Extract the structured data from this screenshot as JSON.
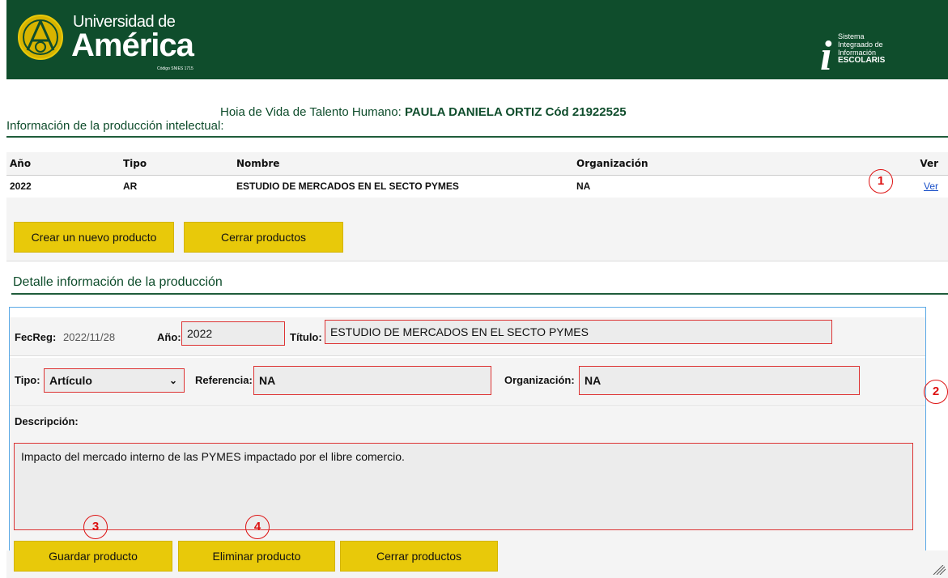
{
  "header": {
    "uni_line1": "Universidad de",
    "uni_line2": "América",
    "uni_code": "Código SNIES 1715",
    "system_lines": [
      "Sistema",
      "Integraado de",
      "Información",
      "ESCOLARIS"
    ],
    "system_letter": "i",
    "colors": {
      "brand_green": "#0f4d2c",
      "accent_yellow": "#e8c90a",
      "mark_red": "#d11111",
      "link_blue": "#1a50c8"
    }
  },
  "title": {
    "prefix": "Hoia de Vida de Talento Humano:",
    "person": "PAULA DANIELA ORTIZ",
    "cod_label": "Cód",
    "cod_value": "21922525"
  },
  "section1": {
    "heading": "Información de la producción intelectual:"
  },
  "table": {
    "headers": {
      "year": "Año",
      "type": "Tipo",
      "name": "Nombre",
      "org": "Organización",
      "ver": "Ver"
    },
    "rows": [
      {
        "year": "2022",
        "type": "AR",
        "name": "ESTUDIO DE MERCADOS EN EL SECTO PYMES",
        "org": "NA",
        "ver": "Ver"
      }
    ]
  },
  "top_buttons": {
    "new": "Crear un nuevo producto",
    "close": "Cerrar productos"
  },
  "detail": {
    "heading": "Detalle información de la producción",
    "fecreg_label": "FecReg:",
    "fecreg_value": "2022/11/28",
    "year_label": "Año:",
    "year_value": "2022",
    "title_label": "Título:",
    "title_value": "ESTUDIO DE MERCADOS EN EL SECTO PYMES",
    "type_label": "Tipo:",
    "type_value": "Artículo",
    "ref_label": "Referencia:",
    "ref_value": "NA",
    "org_label": "Organización:",
    "org_value": "NA",
    "desc_label": "Descripción:",
    "desc_value": "Impacto del mercado interno de las PYMES impactado por el libre comercio."
  },
  "bottom_buttons": {
    "save": "Guardar producto",
    "delete": "Eliminar producto",
    "close": "Cerrar productos"
  },
  "markers": [
    "1",
    "2",
    "3",
    "4"
  ]
}
